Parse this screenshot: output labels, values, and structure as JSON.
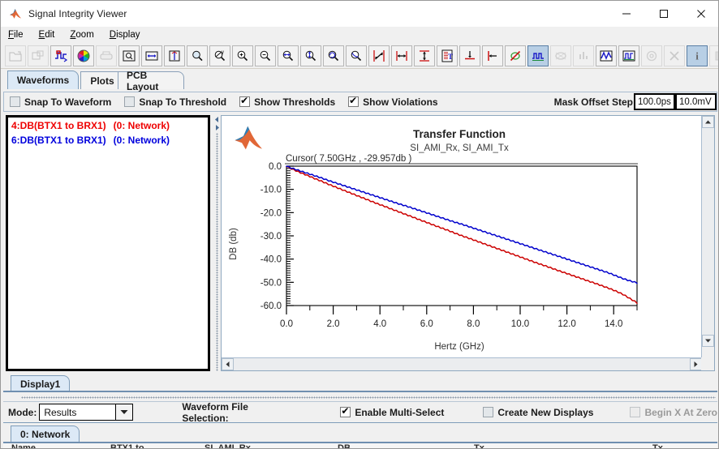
{
  "window": {
    "title": "Signal Integrity Viewer",
    "icon": "matlab-logo-icon",
    "minimize": "–",
    "maximize": "□",
    "close": "✕"
  },
  "menu": [
    {
      "label": "File",
      "mnemonic": "F"
    },
    {
      "label": "Edit",
      "mnemonic": "E"
    },
    {
      "label": "Zoom",
      "mnemonic": "Z"
    },
    {
      "label": "Display",
      "mnemonic": "D"
    }
  ],
  "toolbar": {
    "buttons": [
      {
        "name": "open-file-icon",
        "enabled": false,
        "selected": false
      },
      {
        "name": "save-file-icon",
        "enabled": false,
        "selected": false
      },
      {
        "name": "edit-waveform-icon",
        "enabled": true,
        "selected": false
      },
      {
        "name": "color-wheel-icon",
        "enabled": true,
        "selected": false
      },
      {
        "name": "print-icon",
        "enabled": false,
        "selected": false
      },
      {
        "name": "zoom-page-icon",
        "enabled": true,
        "selected": false
      },
      {
        "name": "zoom-horizontal-fit-icon",
        "enabled": true,
        "selected": false
      },
      {
        "name": "zoom-vertical-fit-icon",
        "enabled": true,
        "selected": false
      },
      {
        "name": "zoom-select-icon",
        "enabled": true,
        "selected": false
      },
      {
        "name": "zoom-xy-icon",
        "enabled": true,
        "selected": false
      },
      {
        "name": "zoom-in-icon",
        "enabled": true,
        "selected": false
      },
      {
        "name": "zoom-out-icon",
        "enabled": true,
        "selected": false
      },
      {
        "name": "zoom-horizontal-icon",
        "enabled": true,
        "selected": false
      },
      {
        "name": "zoom-vertical-icon",
        "enabled": true,
        "selected": false
      },
      {
        "name": "zoom-previous-icon",
        "enabled": true,
        "selected": false
      },
      {
        "name": "zoom-full-icon",
        "enabled": true,
        "selected": false
      },
      {
        "name": "cursor-diagonal-icon",
        "enabled": true,
        "selected": false
      },
      {
        "name": "measure-horizontal-icon",
        "enabled": true,
        "selected": false
      },
      {
        "name": "measure-vertical-icon",
        "enabled": true,
        "selected": false
      },
      {
        "name": "text-report-icon",
        "enabled": true,
        "selected": false
      },
      {
        "name": "ground-reference-icon",
        "enabled": true,
        "selected": false
      },
      {
        "name": "left-marker-icon",
        "enabled": true,
        "selected": false
      },
      {
        "name": "no-circle-icon",
        "enabled": true,
        "selected": false
      },
      {
        "name": "waveform-view-icon",
        "enabled": true,
        "selected": true
      },
      {
        "name": "eye-diagram-icon",
        "enabled": false,
        "selected": false
      },
      {
        "name": "histogram-icon",
        "enabled": false,
        "selected": false
      },
      {
        "name": "signal-trace-icon",
        "enabled": true,
        "selected": false
      },
      {
        "name": "digital-waveform-icon",
        "enabled": true,
        "selected": false
      },
      {
        "name": "target-icon",
        "enabled": false,
        "selected": false
      },
      {
        "name": "delete-x-icon",
        "enabled": false,
        "selected": false
      },
      {
        "name": "info-icon",
        "enabled": true,
        "selected": true
      },
      {
        "name": "grid-icon",
        "enabled": false,
        "selected": false
      }
    ]
  },
  "tabs": [
    {
      "label": "Waveforms",
      "active": true
    },
    {
      "label": "Plots",
      "active": false
    },
    {
      "label": "PCB Layout",
      "active": false
    }
  ],
  "options_bar": {
    "checkboxes": [
      {
        "label": "Snap To Waveform",
        "checked": false,
        "enabled": true
      },
      {
        "label": "Snap To Threshold",
        "checked": false,
        "enabled": true
      },
      {
        "label": "Show Thresholds",
        "checked": true,
        "enabled": true
      },
      {
        "label": "Show Violations",
        "checked": true,
        "enabled": true
      }
    ],
    "mask_offset_label": "Mask Offset Step",
    "mask_time_value": "100.0ps",
    "mask_voltage_value": "10.0mV"
  },
  "waveform_list": {
    "items": [
      {
        "id": "4:DB(BTX1 to BRX1)",
        "network": "(0: Network)",
        "color": "#ee0000"
      },
      {
        "id": "6:DB(BTX1 to BRX1)",
        "network": "(0: Network)",
        "color": "#0000dd"
      }
    ]
  },
  "display_tabs": [
    {
      "label": "Display1",
      "active": true
    }
  ],
  "mode_bar": {
    "mode_label": "Mode:",
    "mode_value": "Results",
    "waveform_file_selection_label": "Waveform File Selection:",
    "checkboxes": [
      {
        "label": "Enable Multi-Select",
        "checked": true,
        "enabled": true
      },
      {
        "label": "Create New Displays",
        "checked": false,
        "enabled": true
      },
      {
        "label": "Begin X At Zero",
        "checked": false,
        "enabled": false
      }
    ]
  },
  "network_tabs": [
    {
      "label": "0: Network",
      "active": true
    }
  ],
  "chart_data": {
    "type": "line",
    "title": "Transfer Function",
    "subtitle": "SI_AMI_Rx, SI_AMI_Tx",
    "cursor_annotation": "Cursor( 7.50GHz , -29.957db )",
    "xlabel": "Hertz (GHz)",
    "ylabel": "DB (db)",
    "xlim": [
      0.0,
      15.0
    ],
    "ylim": [
      -60.0,
      0.0
    ],
    "xticks": [
      0.0,
      2.0,
      4.0,
      6.0,
      8.0,
      10.0,
      12.0,
      14.0
    ],
    "xticklabels": [
      "0.0",
      "2.0",
      "4.0",
      "6.0",
      "8.0",
      "10.0",
      "12.0",
      "14.0"
    ],
    "yticks": [
      0.0,
      -10.0,
      -20.0,
      -30.0,
      -40.0,
      -50.0,
      -60.0
    ],
    "yticklabels": [
      "0.0",
      "-10.0",
      "-20.0",
      "-30.0",
      "-40.0",
      "-50.0",
      "-60.0"
    ],
    "x_minor_tick_count": 2,
    "y_minor_tick_count": 9,
    "grid": false,
    "legend": null,
    "series": [
      {
        "name": "4:DB(BTX1 to BRX1)",
        "color": "#cc0000",
        "x": [
          0.0,
          0.3,
          0.6,
          0.9,
          1.2,
          1.5,
          1.8,
          2.1,
          2.4,
          2.7,
          3.0,
          3.3,
          3.6,
          3.9,
          4.2,
          4.5,
          4.8,
          5.1,
          5.4,
          5.7,
          6.0,
          6.3,
          6.6,
          6.9,
          7.2,
          7.5,
          7.8,
          8.1,
          8.4,
          8.7,
          9.0,
          9.3,
          9.6,
          9.9,
          10.2,
          10.5,
          10.8,
          11.1,
          11.4,
          11.7,
          12.0,
          12.3,
          12.6,
          12.9,
          13.2,
          13.5,
          13.8,
          14.1,
          14.4,
          14.7,
          15.0
        ],
        "y": [
          -0.2,
          -1.5,
          -2.8,
          -4.0,
          -5.3,
          -6.5,
          -7.8,
          -9.0,
          -10.2,
          -11.4,
          -12.6,
          -13.8,
          -15.0,
          -16.2,
          -17.3,
          -18.5,
          -19.6,
          -20.8,
          -21.9,
          -23.1,
          -24.2,
          -25.4,
          -26.5,
          -27.6,
          -28.8,
          -29.957,
          -31.0,
          -32.1,
          -33.2,
          -34.3,
          -35.4,
          -36.5,
          -37.6,
          -38.7,
          -39.8,
          -40.9,
          -42.0,
          -43.0,
          -44.1,
          -45.2,
          -46.2,
          -47.3,
          -48.3,
          -49.4,
          -50.4,
          -51.5,
          -52.6,
          -53.8,
          -55.2,
          -57.0,
          -58.8
        ]
      },
      {
        "name": "6:DB(BTX1 to BRX1)",
        "color": "#0000cc",
        "x": [
          0.0,
          0.3,
          0.6,
          0.9,
          1.2,
          1.5,
          1.8,
          2.1,
          2.4,
          2.7,
          3.0,
          3.3,
          3.6,
          3.9,
          4.2,
          4.5,
          4.8,
          5.1,
          5.4,
          5.7,
          6.0,
          6.3,
          6.6,
          6.9,
          7.2,
          7.5,
          7.8,
          8.1,
          8.4,
          8.7,
          9.0,
          9.3,
          9.6,
          9.9,
          10.2,
          10.5,
          10.8,
          11.1,
          11.4,
          11.7,
          12.0,
          12.3,
          12.6,
          12.9,
          13.2,
          13.5,
          13.8,
          14.1,
          14.4,
          14.7,
          15.0
        ],
        "y": [
          -0.1,
          -1.1,
          -2.1,
          -3.1,
          -4.1,
          -5.1,
          -6.2,
          -7.2,
          -8.2,
          -9.2,
          -10.2,
          -11.2,
          -12.2,
          -13.2,
          -14.2,
          -15.2,
          -16.2,
          -17.1,
          -18.1,
          -19.1,
          -20.1,
          -21.1,
          -22.1,
          -23.1,
          -24.1,
          -25.0,
          -26.0,
          -27.0,
          -28.0,
          -29.0,
          -30.0,
          -31.0,
          -32.0,
          -33.0,
          -34.0,
          -35.0,
          -36.0,
          -37.0,
          -38.0,
          -39.0,
          -40.0,
          -41.0,
          -42.0,
          -43.0,
          -44.0,
          -45.0,
          -46.0,
          -47.2,
          -48.4,
          -49.4,
          -50.2
        ]
      }
    ]
  }
}
